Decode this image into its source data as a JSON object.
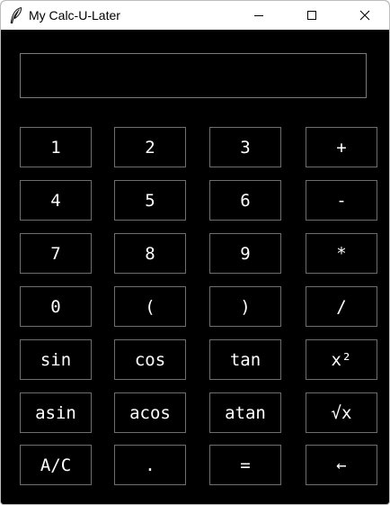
{
  "window": {
    "title": "My Calc-U-Later",
    "icon": "feather-icon"
  },
  "display": {
    "value": ""
  },
  "keypad": {
    "rows": [
      [
        {
          "label": "1",
          "name": "key-1-button"
        },
        {
          "label": "2",
          "name": "key-2-button"
        },
        {
          "label": "3",
          "name": "key-3-button"
        },
        {
          "label": "+",
          "name": "add-button"
        }
      ],
      [
        {
          "label": "4",
          "name": "key-4-button"
        },
        {
          "label": "5",
          "name": "key-5-button"
        },
        {
          "label": "6",
          "name": "key-6-button"
        },
        {
          "label": "-",
          "name": "subtract-button"
        }
      ],
      [
        {
          "label": "7",
          "name": "key-7-button"
        },
        {
          "label": "8",
          "name": "key-8-button"
        },
        {
          "label": "9",
          "name": "key-9-button"
        },
        {
          "label": "*",
          "name": "multiply-button"
        }
      ],
      [
        {
          "label": "0",
          "name": "key-0-button"
        },
        {
          "label": "(",
          "name": "open-paren-button"
        },
        {
          "label": ")",
          "name": "close-paren-button"
        },
        {
          "label": "/",
          "name": "divide-button"
        }
      ],
      [
        {
          "label": "sin",
          "name": "sin-button"
        },
        {
          "label": "cos",
          "name": "cos-button"
        },
        {
          "label": "tan",
          "name": "tan-button"
        },
        {
          "label": "x²",
          "name": "square-button"
        }
      ],
      [
        {
          "label": "asin",
          "name": "asin-button"
        },
        {
          "label": "acos",
          "name": "acos-button"
        },
        {
          "label": "atan",
          "name": "atan-button"
        },
        {
          "label": "√x",
          "name": "square-root-button"
        }
      ],
      [
        {
          "label": "A/C",
          "name": "all-clear-button"
        },
        {
          "label": ".",
          "name": "decimal-point-button"
        },
        {
          "label": "=",
          "name": "equals-button"
        },
        {
          "label": "←",
          "name": "backspace-button"
        }
      ]
    ]
  },
  "colors": {
    "background": "#000000",
    "key_text": "#ffffff",
    "key_border": "#6e6e6e",
    "titlebar": "#ffffff"
  }
}
